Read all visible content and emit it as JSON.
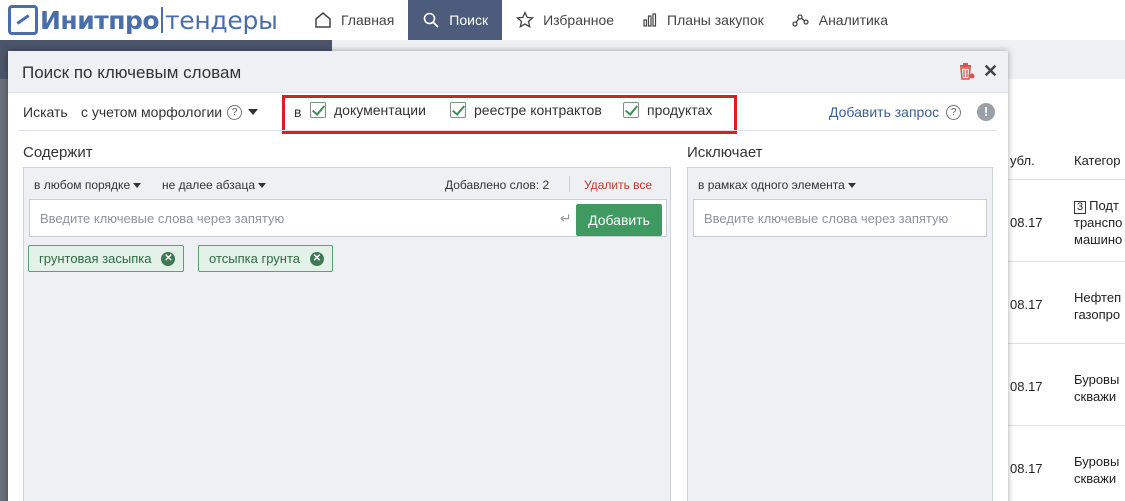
{
  "nav": {
    "logo_main": "Инитпро",
    "logo_sub": "тендеры",
    "items": [
      {
        "label": "Главная",
        "icon": "home-icon"
      },
      {
        "label": "Поиск",
        "icon": "search-icon",
        "active": true
      },
      {
        "label": "Избранное",
        "icon": "star-icon"
      },
      {
        "label": "Планы закупок",
        "icon": "bar-chart-icon"
      },
      {
        "label": "Аналитика",
        "icon": "analytics-icon"
      }
    ]
  },
  "background": {
    "col_date": "убл.",
    "col_category": "Категор",
    "rows": [
      {
        "date": "08.17",
        "num": "3",
        "cat": [
          "Подт",
          "транспо",
          "машино"
        ]
      },
      {
        "date": "08.17",
        "cat": [
          "Нефтеп",
          "газопро"
        ]
      },
      {
        "date": "08.17",
        "cat": [
          "Буровы",
          "скважи"
        ]
      },
      {
        "date": "08.17",
        "cat": [
          "Буровы",
          "скважи"
        ]
      }
    ]
  },
  "dialog": {
    "title": "Поиск по ключевым словам",
    "search_label": "Искать",
    "morphology": "с учетом морфологии",
    "in_label": "в",
    "scopes": [
      "документации",
      "реестре контрактов",
      "продуктах"
    ],
    "add_query": "Добавить запрос",
    "contains": {
      "title": "Содержит",
      "order": "в любом порядке",
      "distance": "не далее абзаца",
      "count": "Добавлено слов: 2",
      "delete_all": "Удалить все",
      "placeholder": "Введите ключевые слова через запятую",
      "add_button": "Добавить",
      "tags": [
        "грунтовая засыпка",
        "отсыпка грунта"
      ]
    },
    "excludes": {
      "title": "Исключает",
      "scope": "в рамках одного элемента",
      "placeholder": "Введите ключевые слова через запятую"
    }
  },
  "colors": {
    "nav_active": "#4d5b7c",
    "brand": "#4a6ea9",
    "accent_green": "#3f9a62",
    "highlight_red": "#d91f26",
    "danger_red": "#c0392b"
  }
}
